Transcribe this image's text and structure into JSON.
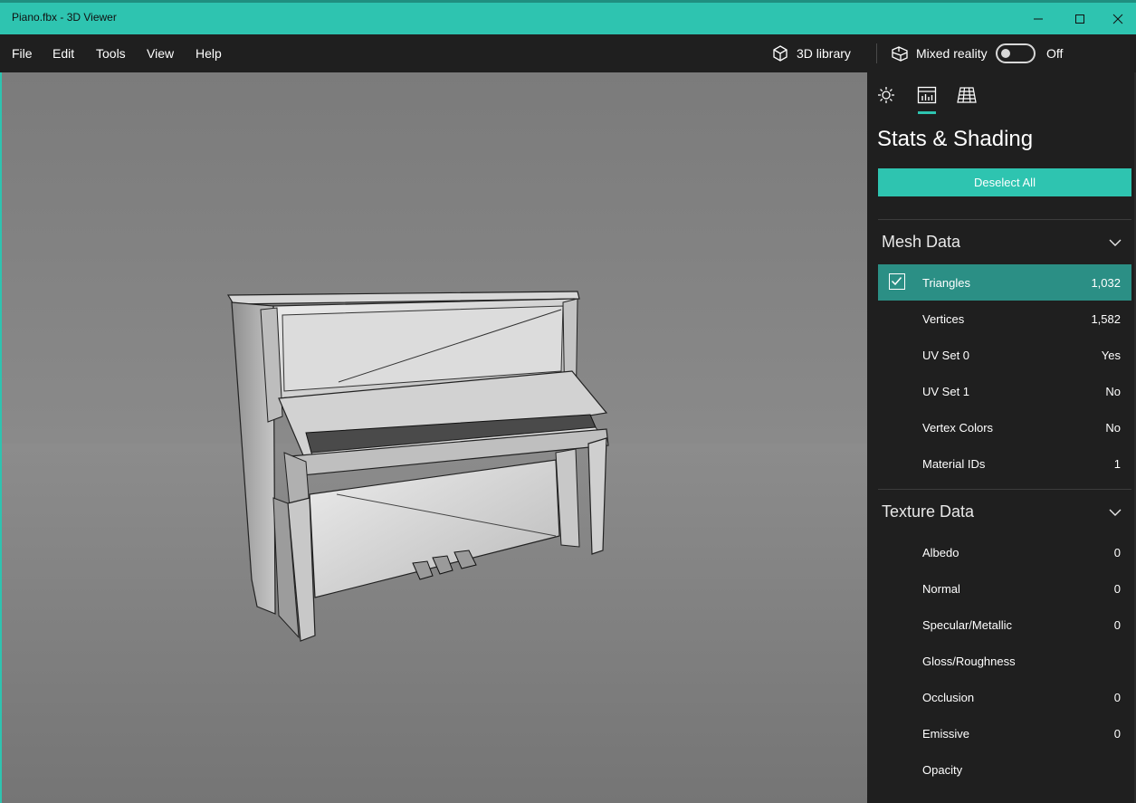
{
  "window": {
    "title": "Piano.fbx - 3D Viewer"
  },
  "menu": {
    "items": [
      "File",
      "Edit",
      "Tools",
      "View",
      "Help"
    ],
    "library_label": "3D library",
    "mixed_reality_label": "Mixed reality",
    "mixed_reality_state": "Off"
  },
  "panel": {
    "tabs": [
      "lighting-icon",
      "stats-icon",
      "grid-icon"
    ],
    "active_tab": "stats-icon",
    "title": "Stats & Shading",
    "deselect_label": "Deselect All",
    "mesh_header": "Mesh Data",
    "mesh_rows": [
      {
        "label": "Triangles",
        "value": "1,032",
        "selected": true
      },
      {
        "label": "Vertices",
        "value": "1,582"
      },
      {
        "label": "UV Set 0",
        "value": "Yes"
      },
      {
        "label": "UV Set 1",
        "value": "No"
      },
      {
        "label": "Vertex Colors",
        "value": "No"
      },
      {
        "label": "Material IDs",
        "value": "1"
      }
    ],
    "texture_header": "Texture Data",
    "texture_rows": [
      {
        "label": "Albedo",
        "value": "0"
      },
      {
        "label": "Normal",
        "value": "0"
      },
      {
        "label": "Specular/Metallic",
        "value": "0"
      },
      {
        "label": "Gloss/Roughness",
        "value": ""
      },
      {
        "label": "Occlusion",
        "value": "0"
      },
      {
        "label": "Emissive",
        "value": "0"
      },
      {
        "label": "Opacity",
        "value": ""
      }
    ]
  },
  "colors": {
    "accent": "#2ec4b0",
    "selected_row": "#2b8f85",
    "background": "#1f1f1f"
  }
}
